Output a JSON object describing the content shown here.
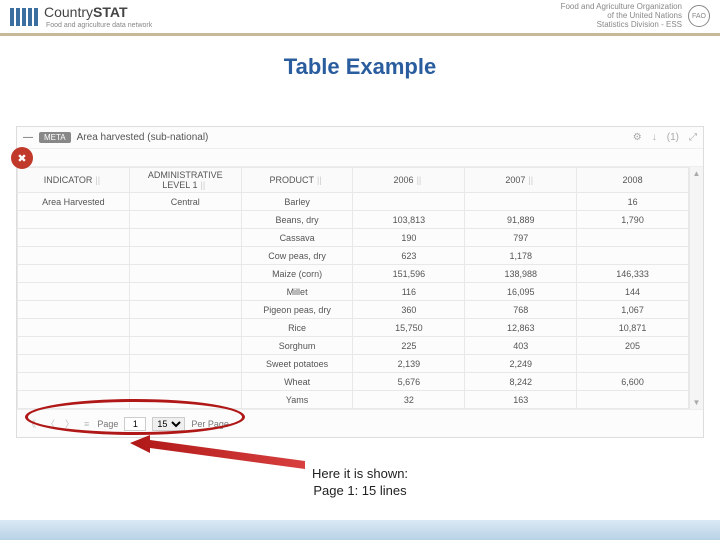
{
  "header": {
    "brand_prefix": "Country",
    "brand_suffix": "STAT",
    "tagline": "Food and agriculture data network",
    "org_line1": "Food and Agriculture Organization",
    "org_line2": "of the United Nations",
    "org_line3": "Statistics Division - ESS",
    "emblem": "FAO"
  },
  "title": "Table Example",
  "panel": {
    "meta": "META",
    "dataset": "Area harvested (sub-national)",
    "collapse": "—",
    "icons": {
      "gear": "⚙",
      "download": "↓",
      "count": "(1)",
      "expand": "⤢"
    },
    "wrench": "✖"
  },
  "table": {
    "headers": [
      "INDICATOR",
      "ADMINISTRATIVE LEVEL 1",
      "PRODUCT",
      "2006",
      "2007",
      "2008"
    ],
    "indicator": "Area Harvested",
    "admin": "Central",
    "rows": [
      {
        "product": "Barley",
        "y2006": "",
        "y2007": "",
        "y2008": "16"
      },
      {
        "product": "Beans, dry",
        "y2006": "103,813",
        "y2007": "91,889",
        "y2008": "1,790"
      },
      {
        "product": "Cassava",
        "y2006": "190",
        "y2007": "797",
        "y2008": ""
      },
      {
        "product": "Cow peas, dry",
        "y2006": "623",
        "y2007": "1,178",
        "y2008": ""
      },
      {
        "product": "Maize (corn)",
        "y2006": "151,596",
        "y2007": "138,988",
        "y2008": "146,333"
      },
      {
        "product": "Millet",
        "y2006": "116",
        "y2007": "16,095",
        "y2008": "144"
      },
      {
        "product": "Pigeon peas, dry",
        "y2006": "360",
        "y2007": "768",
        "y2008": "1,067"
      },
      {
        "product": "Rice",
        "y2006": "15,750",
        "y2007": "12,863",
        "y2008": "10,871"
      },
      {
        "product": "Sorghum",
        "y2006": "225",
        "y2007": "403",
        "y2008": "205"
      },
      {
        "product": "Sweet potatoes",
        "y2006": "2,139",
        "y2007": "2,249",
        "y2008": ""
      },
      {
        "product": "Wheat",
        "y2006": "5,676",
        "y2007": "8,242",
        "y2008": "6,600"
      },
      {
        "product": "Yams",
        "y2006": "32",
        "y2007": "163",
        "y2008": ""
      }
    ]
  },
  "pager": {
    "first": "《",
    "prev": "〈",
    "next": "〉",
    "menu": "≡",
    "page_label": "Page",
    "page_value": "1",
    "per_page_value": "15",
    "per_page_label": "Per Page"
  },
  "caption": {
    "line1": "Here it is shown:",
    "line2": "Page 1: 15 lines"
  }
}
